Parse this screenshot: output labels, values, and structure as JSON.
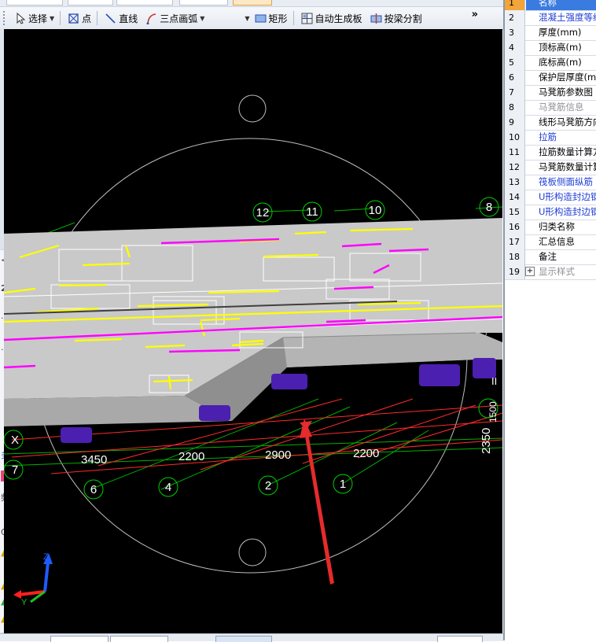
{
  "toolbar": {
    "select_label": "选择",
    "point_label": "点",
    "line_label": "直线",
    "arc_label": "三点画弧",
    "rect_label": "矩形",
    "auto_slab_label": "自动生成板",
    "split_by_beam_label": "按梁分割",
    "more_glyph": "»"
  },
  "viewport": {
    "axis_labels": [
      "12",
      "11",
      "10",
      "8",
      "6",
      "4",
      "2",
      "1",
      "7",
      "X"
    ],
    "dimensions": [
      "3450",
      "2200",
      "2900",
      "2200",
      "2350",
      "1500"
    ],
    "right_edge_label": "II",
    "colors": {
      "background": "#000000",
      "slab": "#c9c9c9",
      "slab_side": "#a9a9a9",
      "rebar_yellow": "#ffff00",
      "rebar_magenta": "#ff00ff",
      "grid_red": "#ff2a2a",
      "grid_green": "#00c000",
      "column_purple": "#4b1fb0",
      "arrow": "#e52b2b",
      "axis_bubble": "#00d000"
    },
    "gizmo": {
      "z": "Z",
      "y": "Y"
    }
  },
  "left_panel": {
    "items": [
      "<",
      "2",
      "多",
      "频",
      "Q"
    ]
  },
  "properties": {
    "rows": [
      {
        "num": "1",
        "name": "名称",
        "style": "selected"
      },
      {
        "num": "2",
        "name": "混凝土强度等级",
        "style": "blue"
      },
      {
        "num": "3",
        "name": "厚度(mm)",
        "style": "normal"
      },
      {
        "num": "4",
        "name": "顶标高(m)",
        "style": "normal"
      },
      {
        "num": "5",
        "name": "底标高(m)",
        "style": "normal"
      },
      {
        "num": "6",
        "name": "保护层厚度(mm)",
        "style": "normal"
      },
      {
        "num": "7",
        "name": "马凳筋参数图",
        "style": "normal"
      },
      {
        "num": "8",
        "name": "马凳筋信息",
        "style": "gray"
      },
      {
        "num": "9",
        "name": "线形马凳筋方向",
        "style": "normal"
      },
      {
        "num": "10",
        "name": "拉筋",
        "style": "blue"
      },
      {
        "num": "11",
        "name": "拉筋数量计算方式",
        "style": "normal"
      },
      {
        "num": "12",
        "name": "马凳筋数量计算方式",
        "style": "normal"
      },
      {
        "num": "13",
        "name": "筏板侧面纵筋",
        "style": "blue"
      },
      {
        "num": "14",
        "name": "U形构造封边钢筋",
        "style": "blue"
      },
      {
        "num": "15",
        "name": "U形构造封边钢筋弯折长度",
        "style": "blue"
      },
      {
        "num": "16",
        "name": "归类名称",
        "style": "normal"
      },
      {
        "num": "17",
        "name": "汇总信息",
        "style": "normal"
      },
      {
        "num": "18",
        "name": "备注",
        "style": "normal"
      },
      {
        "num": "19",
        "name": "显示样式",
        "style": "gray-expand"
      }
    ]
  }
}
